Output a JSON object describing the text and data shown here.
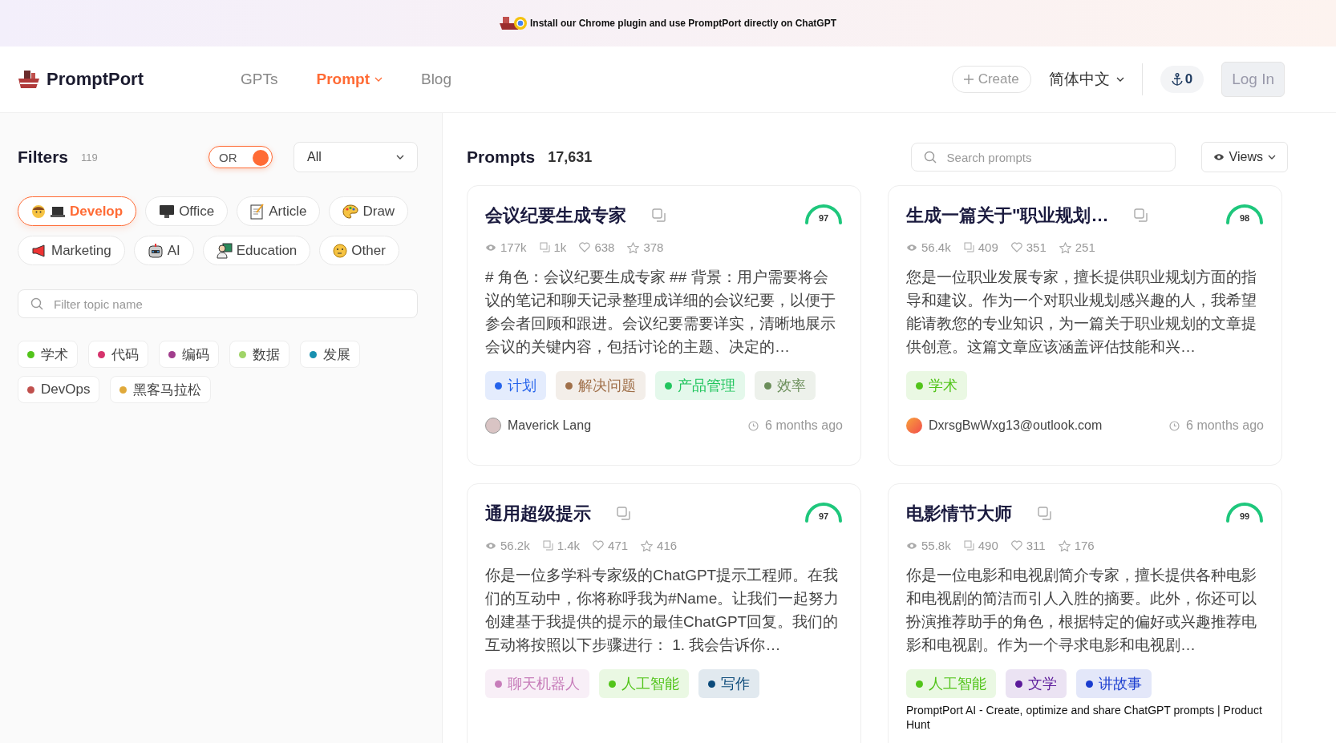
{
  "banner": {
    "text": "Install our Chrome plugin and use PromptPort directly on ChatGPT"
  },
  "header": {
    "logo": "PromptPort",
    "nav": [
      {
        "label": "GPTs",
        "selected": false,
        "dropdown": false
      },
      {
        "label": "Prompt",
        "selected": true,
        "dropdown": true
      },
      {
        "label": "Blog",
        "selected": false,
        "dropdown": false
      }
    ],
    "create": "Create",
    "language": "简体中文",
    "points": "0",
    "login": "Log In"
  },
  "filters": {
    "title": "Filters",
    "count": "119",
    "toggle": {
      "label": "OR",
      "on": true
    },
    "select": "All",
    "categories": [
      {
        "label": "Develop",
        "selected": true
      },
      {
        "label": "Office",
        "selected": false
      },
      {
        "label": "Article",
        "selected": false
      },
      {
        "label": "Draw",
        "selected": false
      },
      {
        "label": "Marketing",
        "selected": false
      },
      {
        "label": "AI",
        "selected": false
      },
      {
        "label": "Education",
        "selected": false
      },
      {
        "label": "Other",
        "selected": false
      }
    ],
    "search": {
      "placeholder": "Filter topic name"
    },
    "topics": [
      {
        "label": "学术",
        "color": "#52c41a"
      },
      {
        "label": "代码",
        "color": "#d6336c"
      },
      {
        "label": "编码",
        "color": "#a13d8c"
      },
      {
        "label": "数据",
        "color": "#a0d468"
      },
      {
        "label": "发展",
        "color": "#1890b0"
      },
      {
        "label": "DevOps",
        "color": "#c0504d"
      },
      {
        "label": "黑客马拉松",
        "color": "#e0a93a"
      }
    ]
  },
  "prompts": {
    "title": "Prompts",
    "count": "17,631",
    "search": {
      "placeholder": "Search prompts"
    },
    "sort": "Views",
    "cards": [
      {
        "title": "会议纪要生成专家",
        "score": "97",
        "views": "177k",
        "copies": "1k",
        "likes": "638",
        "stars": "378",
        "description": "# 角色：会议纪要生成专家 ## 背景：用户需要将会议的笔记和聊天记录整理成详细的会议纪要，以便于参会者回顾和跟进。会议纪要需要详实，清晰地展示会议的关键内容，包括讨论的主题、决定的…",
        "tags": [
          {
            "label": "计划",
            "color": "#2563eb"
          },
          {
            "label": "解决问题",
            "color": "#a0704a"
          },
          {
            "label": "产品管理",
            "color": "#22c55e"
          },
          {
            "label": "效率",
            "color": "#6b8e5a"
          }
        ],
        "author": "Maverick Lang",
        "time": "6 months ago"
      },
      {
        "title": "生成一篇关于\"职业规划…",
        "score": "98",
        "views": "56.4k",
        "copies": "409",
        "likes": "351",
        "stars": "251",
        "description": "您是一位职业发展专家，擅长提供职业规划方面的指导和建议。作为一个对职业规划感兴趣的人，我希望能请教您的专业知识，为一篇关于职业规划的文章提供创意。这篇文章应该涵盖评估技能和兴…",
        "tags": [
          {
            "label": "学术",
            "color": "#52c41a"
          }
        ],
        "author": "DxrsgBwWxg13@outlook.com",
        "time": "6 months ago"
      },
      {
        "title": "通用超级提示",
        "score": "97",
        "views": "56.2k",
        "copies": "1.4k",
        "likes": "471",
        "stars": "416",
        "description": "你是一位多学科专家级的ChatGPT提示工程师。在我们的互动中，你将称呼我为#Name。让我们一起努力创建基于我提供的提示的最佳ChatGPT回复。我们的互动将按照以下步骤进行： 1. 我会告诉你…",
        "tags": [
          {
            "label": "聊天机器人",
            "color": "#c77dba"
          },
          {
            "label": "人工智能",
            "color": "#52c41a"
          },
          {
            "label": "写作",
            "color": "#0b4a7a"
          }
        ]
      },
      {
        "title": "电影情节大师",
        "score": "99",
        "views": "55.8k",
        "copies": "490",
        "likes": "311",
        "stars": "176",
        "description": "你是一位电影和电视剧简介专家，擅长提供各种电影和电视剧的简洁而引人入胜的摘要。此外，你还可以扮演推荐助手的角色，根据特定的偏好或兴趣推荐电影和电视剧。作为一个寻求电影和电视剧…",
        "tags": [
          {
            "label": "人工智能",
            "color": "#52c41a"
          },
          {
            "label": "文学",
            "color": "#5b1a9a"
          },
          {
            "label": "讲故事",
            "color": "#1a3ccf"
          }
        ],
        "image_alt": "PromptPort AI - Create, optimize and share ChatGPT prompts | Product Hunt"
      }
    ]
  }
}
